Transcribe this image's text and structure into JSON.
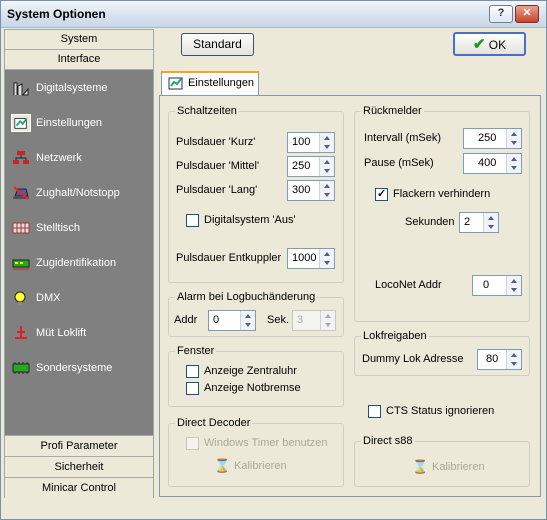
{
  "window": {
    "title": "System Optionen",
    "help": "?",
    "close": "✕"
  },
  "nav": {
    "top": [
      "System",
      "Interface"
    ],
    "items": [
      {
        "label": "Digitalsysteme",
        "icon": "digitalsystem-icon"
      },
      {
        "label": "Einstellungen",
        "icon": "settings-icon"
      },
      {
        "label": "Netzwerk",
        "icon": "network-icon"
      },
      {
        "label": "Zughalt/Notstopp",
        "icon": "stop-icon"
      },
      {
        "label": "Stelltisch",
        "icon": "grid-icon"
      },
      {
        "label": "Zugidentifikation",
        "icon": "train-id-icon"
      },
      {
        "label": "DMX",
        "icon": "light-icon"
      },
      {
        "label": "Müt Loklift",
        "icon": "lift-icon"
      },
      {
        "label": "Sondersysteme",
        "icon": "module-icon"
      }
    ],
    "bottom": [
      "Profi Parameter",
      "Sicherheit",
      "Minicar Control"
    ]
  },
  "buttons": {
    "standard": "Standard",
    "ok": "OK"
  },
  "tab": {
    "label": "Einstellungen"
  },
  "schaltzeiten": {
    "title": "Schaltzeiten",
    "kurz_label": "Pulsdauer 'Kurz'",
    "kurz": "100",
    "mittel_label": "Pulsdauer 'Mittel'",
    "mittel": "250",
    "lang_label": "Pulsdauer 'Lang'",
    "lang": "300",
    "aus_label": "Digitalsystem 'Aus'",
    "entkuppler_label": "Pulsdauer Entkuppler",
    "entkuppler": "1000"
  },
  "alarm": {
    "title": "Alarm bei Logbuchänderung",
    "addr_label": "Addr",
    "addr": "0",
    "sek_label": "Sek.",
    "sek": "3"
  },
  "fenster": {
    "title": "Fenster",
    "zentraluhr": "Anzeige Zentraluhr",
    "notbremse": "Anzeige Notbremse"
  },
  "direct_decoder": {
    "title": "Direct Decoder",
    "timer": "Windows Timer benutzen",
    "kalibrieren": "Kalibrieren"
  },
  "rueckmelder": {
    "title": "Rückmelder",
    "intervall_label": "Intervall (mSek)",
    "intervall": "250",
    "pause_label": "Pause (mSek)",
    "pause": "400",
    "flackern_label": "Flackern verhindern",
    "sekunden_label": "Sekunden",
    "sekunden": "2",
    "loconet_label": "LocoNet Addr",
    "loconet": "0"
  },
  "lokfreigaben": {
    "title": "Lokfreigaben",
    "dummy_label": "Dummy Lok Adresse",
    "dummy": "80"
  },
  "cts": {
    "label": "CTS Status ignorieren"
  },
  "direct_s88": {
    "title": "Direct s88",
    "kalibrieren": "Kalibrieren"
  }
}
